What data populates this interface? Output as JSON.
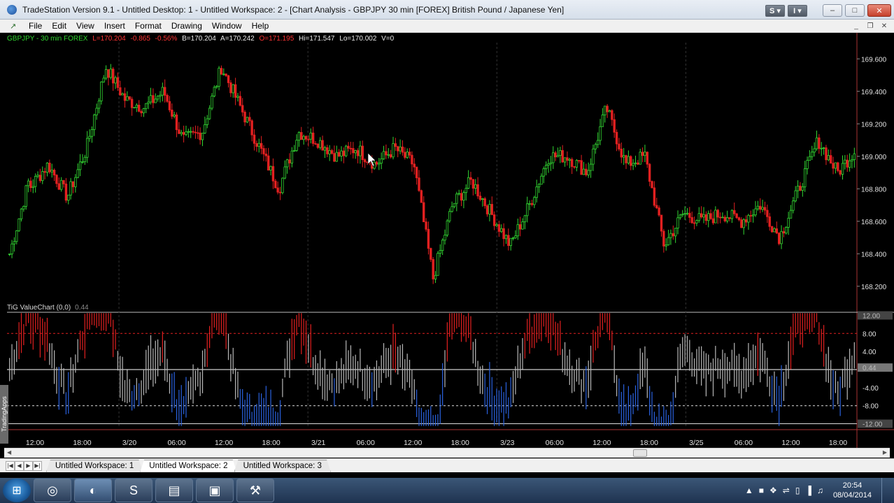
{
  "window": {
    "title": "TradeStation Version 9.1 - Untitled Desktop: 1 - Untitled Workspace:  2 - [Chart Analysis - GBPJPY 30 min [FOREX] British Pound / Japanese Yen]",
    "toolbar_s": "S ▾",
    "toolbar_i": "I ▾",
    "min": "–",
    "max": "□",
    "close": "✕"
  },
  "menu": {
    "items": [
      "File",
      "Edit",
      "View",
      "Insert",
      "Format",
      "Drawing",
      "Window",
      "Help"
    ],
    "mdi_min": "_",
    "mdi_restore": "❐",
    "mdi_close": "✕"
  },
  "chart": {
    "symbol": "GBPJPY - 30 min  FOREX",
    "last": "L=170.204",
    "change": "-0.865",
    "change_pct": "-0.56%",
    "bid": "B=170.204",
    "ask": "A=170.242",
    "open": "O=171.195",
    "high": "Hi=171.547",
    "low": "Lo=170.002",
    "volume": "V=0",
    "indicator_name": "TiG ValueChart (0,0)",
    "indicator_value": "0.44",
    "side_tab": "TradingApps",
    "colors": {
      "up": "#32d632",
      "down": "#e32020",
      "neutral_bar": "#b8b8b8",
      "osc_high": "#e32020",
      "osc_low": "#2a62e0",
      "grid": "#2a2a2a"
    }
  },
  "chart_data": [
    {
      "type": "candlestick",
      "title": "GBPJPY - 30 min FOREX",
      "ylim": [
        168.1,
        169.7
      ],
      "y_ticks": [
        "169.600",
        "169.400",
        "169.200",
        "169.000",
        "168.800",
        "168.600",
        "168.400",
        "168.200"
      ],
      "x_ticks": [
        "12:00",
        "18:00",
        "3/20",
        "06:00",
        "12:00",
        "18:00",
        "3/21",
        "06:00",
        "12:00",
        "18:00",
        "3/23",
        "06:00",
        "12:00",
        "18:00",
        "3/25",
        "06:00",
        "12:00",
        "18:00"
      ],
      "segments": [
        [
          168.4,
          168.85
        ],
        [
          168.8,
          168.95
        ],
        [
          168.95,
          168.75
        ],
        [
          168.75,
          169.05
        ],
        [
          169.05,
          169.55
        ],
        [
          169.55,
          169.35
        ],
        [
          169.35,
          169.3
        ],
        [
          169.3,
          169.4
        ],
        [
          169.4,
          169.1
        ],
        [
          169.1,
          169.15
        ],
        [
          169.15,
          169.55
        ],
        [
          169.55,
          169.3
        ],
        [
          169.3,
          169.05
        ],
        [
          169.05,
          168.8
        ],
        [
          168.8,
          169.15
        ],
        [
          169.15,
          169.1
        ],
        [
          169.1,
          169.0
        ],
        [
          169.0,
          169.05
        ],
        [
          169.05,
          168.95
        ],
        [
          168.95,
          169.05
        ],
        [
          169.05,
          168.95
        ],
        [
          168.95,
          168.25
        ],
        [
          168.25,
          168.7
        ],
        [
          168.7,
          168.85
        ],
        [
          168.85,
          168.65
        ],
        [
          168.65,
          168.45
        ],
        [
          168.45,
          168.7
        ],
        [
          168.7,
          169.0
        ],
        [
          169.0,
          169.0
        ],
        [
          169.0,
          168.9
        ],
        [
          168.9,
          169.3
        ],
        [
          169.3,
          168.95
        ],
        [
          168.95,
          169.0
        ],
        [
          169.0,
          168.45
        ],
        [
          168.45,
          168.65
        ],
        [
          168.65,
          168.6
        ],
        [
          168.6,
          168.65
        ],
        [
          168.65,
          168.6
        ],
        [
          168.6,
          168.7
        ],
        [
          168.7,
          168.5
        ],
        [
          168.5,
          168.8
        ],
        [
          168.8,
          169.1
        ],
        [
          169.1,
          168.9
        ],
        [
          168.9,
          169.05
        ]
      ],
      "ohlc_note": "approx. 360 thirty-minute bars following the listed path"
    },
    {
      "type": "bar",
      "title": "TiG ValueChart (0,0)",
      "ylim": [
        -13,
        13
      ],
      "y_ticks": [
        "12.00",
        "8.00",
        "4.00",
        "0.44",
        "-4.00",
        "-8.00",
        "-12.00"
      ],
      "reference_lines": {
        "upper": 8,
        "lower": -8,
        "zero": 0,
        "top": 12,
        "bottom": -12
      },
      "current_value": 0.44
    }
  ],
  "tabs": {
    "workspaces": [
      "Untitled Workspace:  1",
      "Untitled Workspace:  2",
      "Untitled Workspace:  3"
    ],
    "active_index": 1
  },
  "taskbar": {
    "apps": [
      "chrome-icon",
      "tradestation-icon",
      "skype-icon",
      "explorer-icon",
      "photos-icon",
      "tool-icon"
    ],
    "time": "20:54",
    "date": "08/04/2014"
  }
}
